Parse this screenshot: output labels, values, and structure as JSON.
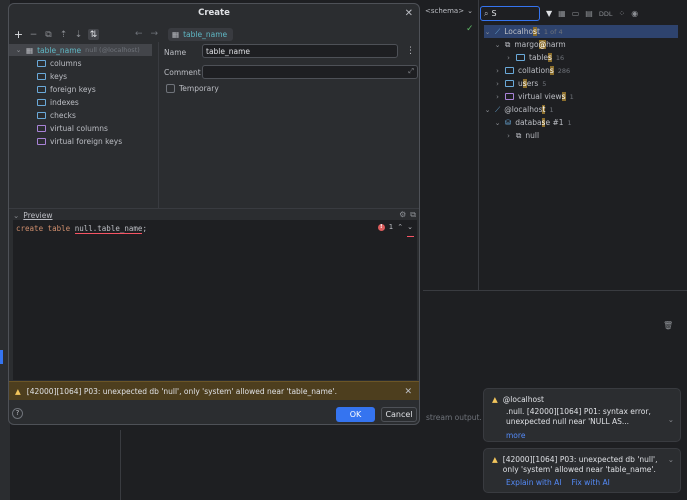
{
  "background": {
    "schema_selector": "<schema>",
    "stream_text": "stream output.",
    "search_value": "S",
    "tree": [
      {
        "pre": "Localho",
        "hl": "s",
        "post": "t",
        "count": "1 of 4"
      },
      {
        "pre": "margo",
        "hl": "@",
        "post": "harm",
        "count": ""
      },
      {
        "pre": "table",
        "hl": "s",
        "post": "",
        "count": "16"
      },
      {
        "pre": "collation",
        "hl": "s",
        "post": "",
        "count": "286"
      },
      {
        "pre": "u",
        "hl": "s",
        "post": "ers",
        "count": "5"
      },
      {
        "pre": "virtual view",
        "hl": "s",
        "post": "",
        "count": "1"
      },
      {
        "pre": "@localhos",
        "hl": "t",
        "post": "",
        "count": "1"
      },
      {
        "pre": "databa",
        "hl": "s",
        "post": "e #1",
        "count": "1"
      },
      {
        "pre": "null",
        "hl": "",
        "post": "",
        "count": ""
      }
    ],
    "toolbar_ddl": "DDL"
  },
  "notifications": [
    {
      "title": "@localhost",
      "body": ".null. [42000][1064] P01: syntax error, unexpected null near 'NULL AS...",
      "links": [
        "more"
      ]
    },
    {
      "title": "",
      "body": "[42000][1064] P03: unexpected db 'null', only 'system' allowed near 'table_name'.",
      "links": [
        "Explain with AI",
        "Fix with AI"
      ]
    }
  ],
  "dialog": {
    "title": "Create",
    "tree_root": {
      "label": "table_name",
      "suffix": "null (@localhost)"
    },
    "tree_children": [
      {
        "label": "columns",
        "kind": "folder"
      },
      {
        "label": "keys",
        "kind": "folder"
      },
      {
        "label": "foreign keys",
        "kind": "folder"
      },
      {
        "label": "indexes",
        "kind": "folder"
      },
      {
        "label": "checks",
        "kind": "folder"
      },
      {
        "label": "virtual columns",
        "kind": "folder-purple"
      },
      {
        "label": "virtual foreign keys",
        "kind": "folder-purple"
      }
    ],
    "tab_label": "table_name",
    "form": {
      "name_label": "Name",
      "name_value": "table_name",
      "comment_label": "Comment",
      "comment_value": "",
      "temporary_label": "Temporary"
    },
    "preview_label": "Preview",
    "preview_code": {
      "kw1": "create",
      "kw2": "table",
      "rest": "null.table_name",
      "tail": ";"
    },
    "error_count": "1",
    "warning": "[42000][1064] P03: unexpected db 'null', only 'system' allowed near 'table_name'.",
    "ok_label": "OK",
    "cancel_label": "Cancel",
    "help_label": "?"
  },
  "colors": {
    "accent": "#3574f0",
    "warning_bg": "#4d3e1e",
    "error": "#db5c5c"
  }
}
